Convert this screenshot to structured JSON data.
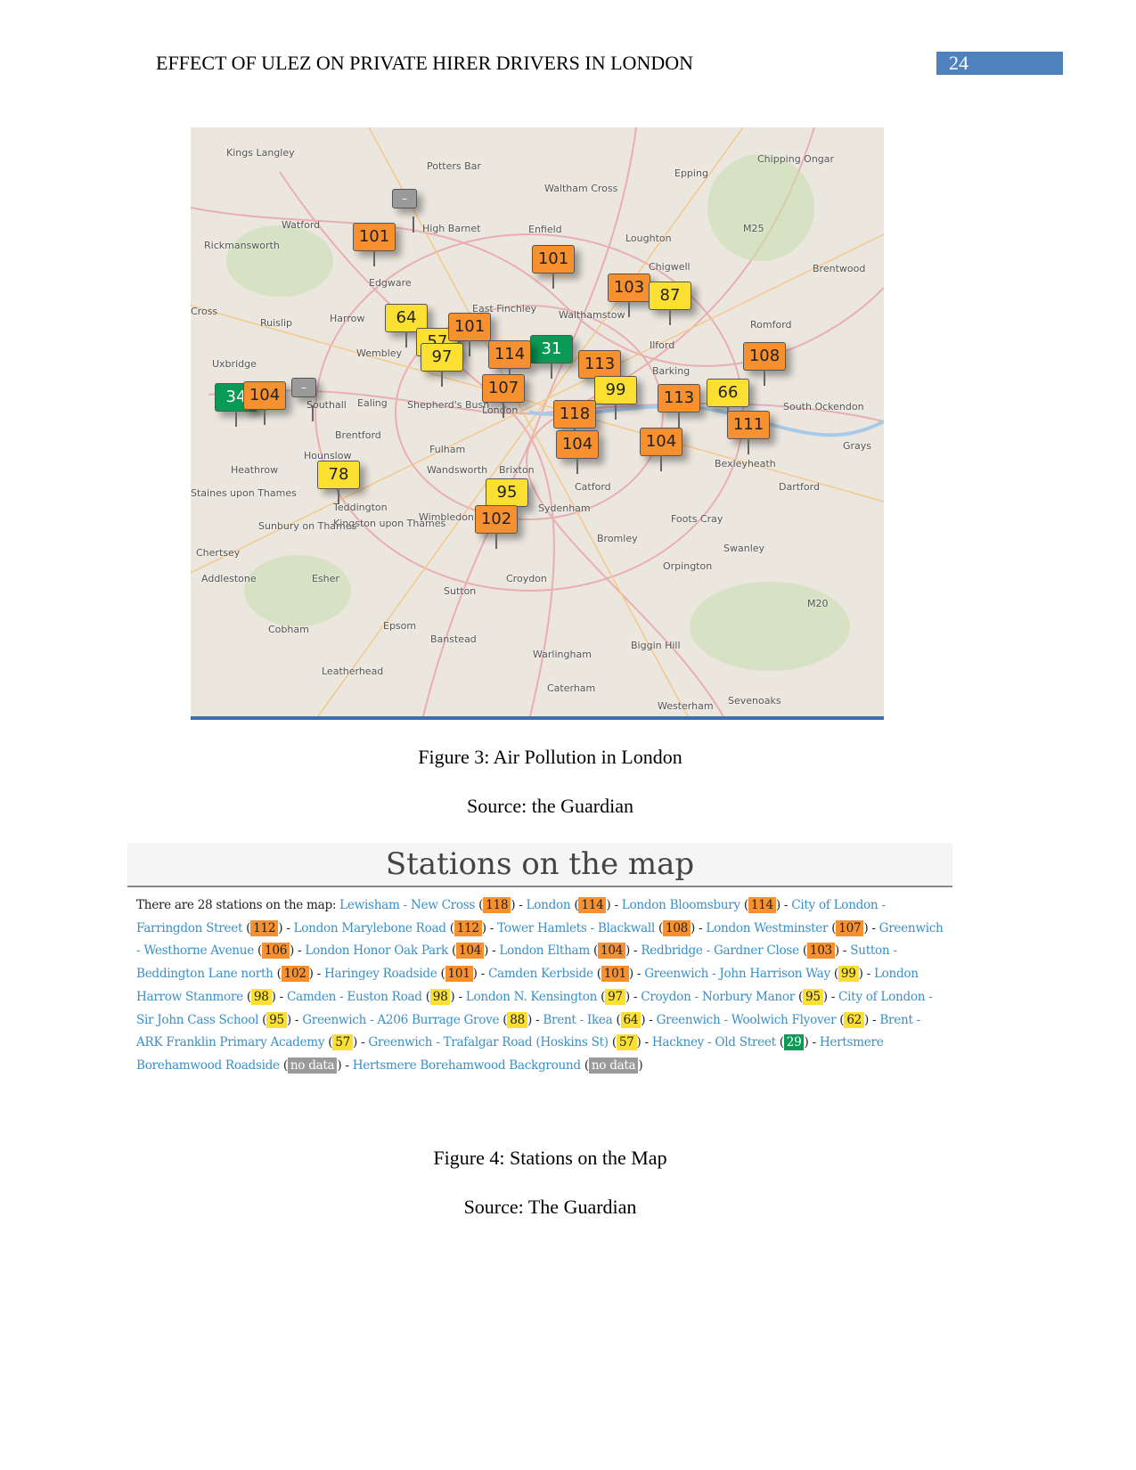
{
  "header": {
    "title": "EFFECT OF ULEZ ON PRIVATE HIRER DRIVERS IN LONDON",
    "page_number": "24"
  },
  "colors": {
    "orange": "#f7902f",
    "yellow": "#fbe032",
    "green": "#0a9a55",
    "gray": "#9a9a9a",
    "link": "#3a8fc4",
    "page_box": "#4f81bd"
  },
  "map": {
    "places": [
      "Kings Langley",
      "Potters Bar",
      "Waltham Cross",
      "Epping",
      "Chipping Ongar",
      "Watford",
      "High Barnet",
      "Enfield",
      "Loughton",
      "M25",
      "Rickmansworth",
      "Edgware",
      "Chigwell",
      "Brentwood",
      "Cross",
      "Ruislip",
      "Harrow",
      "East Finchley",
      "Walthamstow",
      "Romford",
      "Uxbridge",
      "Wembley",
      "Ilford",
      "Barking",
      "Southall",
      "Ealing",
      "Shepherd's Bush",
      "London",
      "South Ockendon",
      "Brentford",
      "Fulham",
      "Heathrow",
      "Hounslow",
      "Wandsworth",
      "Brixton",
      "Catford",
      "Bexleyheath",
      "Grays",
      "Dartford",
      "Staines upon Thames",
      "Teddington",
      "Kingston upon Thames",
      "Wimbledon",
      "Sydenham",
      "Foots Cray",
      "Sunbury on Thames",
      "Bromley",
      "Swanley",
      "Chertsey",
      "Orpington",
      "Addlestone",
      "Esher",
      "Croydon",
      "Sutton",
      "M20",
      "Cobham",
      "Epsom",
      "Banstead",
      "Biggin Hill",
      "Leatherhead",
      "Warlingham",
      "Caterham",
      "Westerham",
      "Sevenoaks"
    ],
    "markers": [
      {
        "value": "101",
        "level": "orange"
      },
      {
        "value": "101",
        "level": "orange"
      },
      {
        "value": "103",
        "level": "orange"
      },
      {
        "value": "87",
        "level": "yellow"
      },
      {
        "value": "64",
        "level": "yellow"
      },
      {
        "value": "57",
        "level": "yellow"
      },
      {
        "value": "101",
        "level": "orange"
      },
      {
        "value": "97",
        "level": "yellow"
      },
      {
        "value": "31",
        "level": "green"
      },
      {
        "value": "114",
        "level": "orange"
      },
      {
        "value": "107",
        "level": "orange"
      },
      {
        "value": "113",
        "level": "orange"
      },
      {
        "value": "108",
        "level": "orange"
      },
      {
        "value": "99",
        "level": "yellow"
      },
      {
        "value": "113",
        "level": "orange"
      },
      {
        "value": "66",
        "level": "yellow"
      },
      {
        "value": "118",
        "level": "orange"
      },
      {
        "value": "104",
        "level": "orange"
      },
      {
        "value": "104",
        "level": "orange"
      },
      {
        "value": "111",
        "level": "orange"
      },
      {
        "value": "34",
        "level": "green"
      },
      {
        "value": "104",
        "level": "orange"
      },
      {
        "value": "–",
        "level": "gray"
      },
      {
        "value": "–",
        "level": "gray"
      },
      {
        "value": "78",
        "level": "yellow"
      },
      {
        "value": "95",
        "level": "yellow"
      },
      {
        "value": "102",
        "level": "orange"
      }
    ]
  },
  "figure3": {
    "caption": "Figure 3: Air Pollution in London",
    "source": "Source: the Guardian"
  },
  "stations": {
    "title": "Stations on the map",
    "intro": "There are 28 stations on the map: ",
    "items": [
      {
        "name": "Lewisham - New Cross",
        "value": "118",
        "level": "orange"
      },
      {
        "name": "London",
        "value": "114",
        "level": "orange"
      },
      {
        "name": "London Bloomsbury",
        "value": "114",
        "level": "orange"
      },
      {
        "name": "City of London - Farringdon Street",
        "value": "112",
        "level": "orange"
      },
      {
        "name": "London Marylebone Road",
        "value": "112",
        "level": "orange"
      },
      {
        "name": "Tower Hamlets - Blackwall",
        "value": "108",
        "level": "orange"
      },
      {
        "name": "London Westminster",
        "value": "107",
        "level": "orange"
      },
      {
        "name": "Greenwich - Westhorne Avenue",
        "value": "106",
        "level": "orange"
      },
      {
        "name": "London Honor Oak Park",
        "value": "104",
        "level": "orange"
      },
      {
        "name": "London Eltham",
        "value": "104",
        "level": "orange"
      },
      {
        "name": "Redbridge - Gardner Close",
        "value": "103",
        "level": "orange"
      },
      {
        "name": "Sutton - Beddington Lane north",
        "value": "102",
        "level": "orange"
      },
      {
        "name": "Haringey Roadside",
        "value": "101",
        "level": "orange"
      },
      {
        "name": "Camden Kerbside",
        "value": "101",
        "level": "orange"
      },
      {
        "name": "Greenwich - John Harrison Way",
        "value": "99",
        "level": "yellow"
      },
      {
        "name": "London Harrow Stanmore",
        "value": "98",
        "level": "yellow"
      },
      {
        "name": "Camden - Euston Road",
        "value": "98",
        "level": "yellow"
      },
      {
        "name": "London N. Kensington",
        "value": "97",
        "level": "yellow"
      },
      {
        "name": "Croydon - Norbury Manor",
        "value": "95",
        "level": "yellow"
      },
      {
        "name": "City of London - Sir John Cass School",
        "value": "95",
        "level": "yellow"
      },
      {
        "name": "Greenwich - A206 Burrage Grove",
        "value": "88",
        "level": "yellow"
      },
      {
        "name": "Brent - Ikea",
        "value": "64",
        "level": "yellow"
      },
      {
        "name": "Greenwich - Woolwich Flyover",
        "value": "62",
        "level": "yellow"
      },
      {
        "name": "Brent - ARK Franklin Primary Academy",
        "value": "57",
        "level": "yellow"
      },
      {
        "name": "Greenwich - Trafalgar Road (Hoskins St)",
        "value": "57",
        "level": "yellow"
      },
      {
        "name": "Hackney - Old Street",
        "value": "29",
        "level": "green"
      },
      {
        "name": "Hertsmere Borehamwood Roadside",
        "value": "no data",
        "level": "gray"
      },
      {
        "name": "Hertsmere Borehamwood Background",
        "value": "no data",
        "level": "gray"
      }
    ]
  },
  "figure4": {
    "caption": "Figure 4: Stations on the Map",
    "source": "Source: The Guardian"
  }
}
